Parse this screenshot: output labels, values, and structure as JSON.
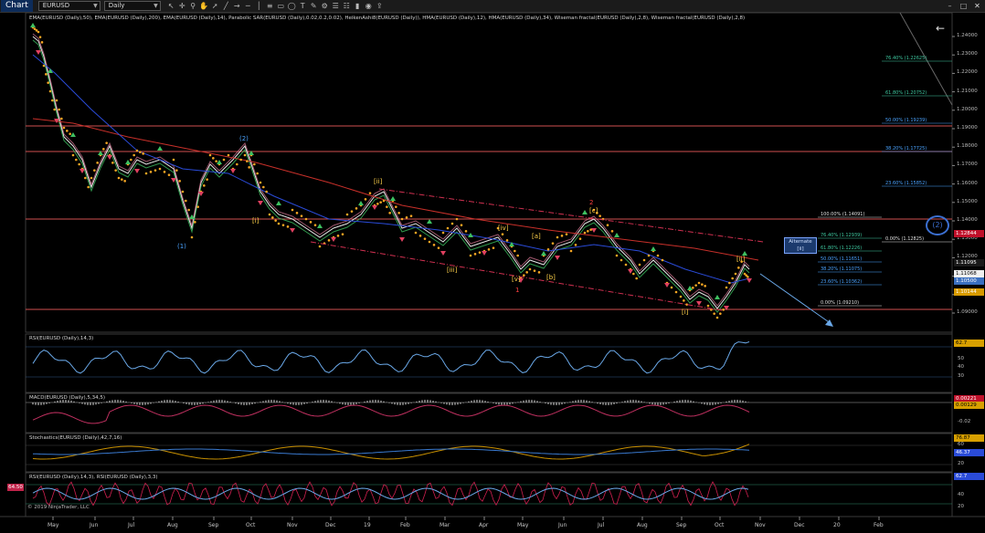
{
  "app": {
    "name": "Chart",
    "instrument": "EURUSD",
    "period": "Daily"
  },
  "toolbar": {
    "icons": [
      "cursor-icon",
      "crosshair-icon",
      "zoom-icon",
      "hand-icon",
      "arrow-icon",
      "line-icon",
      "ray-icon",
      "hline-icon",
      "vline-icon",
      "fib-icon",
      "rect-icon",
      "ellipse-icon",
      "text-icon",
      "pencil-icon",
      "gear-icon",
      "properties-icon",
      "list-icon",
      "bar-style-icon",
      "camera-icon",
      "share-icon"
    ]
  },
  "window": {
    "controls": [
      "minimize",
      "maximize",
      "close"
    ]
  },
  "main_pane": {
    "label": "EMA(EURUSD (Daily),50), EMA(EURUSD (Daily),200), EMA(EURUSD (Daily),14), Parabolic SAR(EURUSD (Daily),0.02,0.2,0.02), HeikenAshi8(EURUSD (Daily)), HMA(EURUSD (Daily),12), HMA(EURUSD (Daily),34), Wiseman fractal(EURUSD (Daily),2,8), Wiseman fractal(EURUSD (Daily),2,8)",
    "y_ticks": [
      "1.24000",
      "1.23000",
      "1.22000",
      "1.21000",
      "1.20000",
      "1.19000",
      "1.18000",
      "1.17000",
      "1.16000",
      "1.15000",
      "1.14000",
      "1.13000",
      "1.12000",
      "1.11000",
      "1.10000",
      "1.09000"
    ],
    "price_badges": [
      {
        "label": "1.12844",
        "color": "#c0102a"
      },
      {
        "label": "1.11095",
        "color": "#1a1a1a"
      },
      {
        "label": "1.11068",
        "color": "#f0f0f0"
      },
      {
        "label": "1.10500",
        "color": "#3a6fc0"
      },
      {
        "label": "1.10144",
        "color": "#d89a00"
      }
    ],
    "fib_upper": [
      {
        "label": "76.40% (1.22625)",
        "color": "#3ec9a0"
      },
      {
        "label": "61.80% (1.20752)",
        "color": "#3ec9a0"
      },
      {
        "label": "50.00% (1.19239)",
        "color": "#4aa3ff"
      },
      {
        "label": "38.20% (1.17725)",
        "color": "#4aa3ff"
      },
      {
        "label": "23.60% (1.15852)",
        "color": "#4aa3ff"
      },
      {
        "label": "0.00% (1.12825)",
        "color": "#e0e0e0"
      }
    ],
    "fib_lower": [
      {
        "label": "100.00% (1.14091)",
        "color": "#e0e0e0"
      },
      {
        "label": "76.40% (1.12939)",
        "color": "#3ec9a0"
      },
      {
        "label": "61.80% (1.12226)",
        "color": "#3ec9a0"
      },
      {
        "label": "50.00% (1.11651)",
        "color": "#4aa3ff"
      },
      {
        "label": "38.20% (1.11075)",
        "color": "#4aa3ff"
      },
      {
        "label": "23.60% (1.10362)",
        "color": "#4aa3ff"
      },
      {
        "label": "0.00% (1.09210)",
        "color": "#e0e0e0"
      }
    ],
    "wave_labels": [
      {
        "text": "(2)",
        "color": "#4aa3ff"
      },
      {
        "text": "(1)",
        "color": "#4aa3ff"
      },
      {
        "text": "[i]",
        "color": "#ffd24a"
      },
      {
        "text": "[ii]",
        "color": "#ffd24a"
      },
      {
        "text": "[iii]",
        "color": "#ffd24a"
      },
      {
        "text": "[iv]",
        "color": "#ffd24a"
      },
      {
        "text": "[v]",
        "color": "#ffd24a"
      },
      {
        "text": "[a]",
        "color": "#ffd24a"
      },
      {
        "text": "[b]",
        "color": "#ffd24a"
      },
      {
        "text": "[c]",
        "color": "#ffd24a"
      },
      {
        "text": "2",
        "color": "#ff4040"
      },
      {
        "text": "1",
        "color": "#ff4040"
      },
      {
        "text": "[i]",
        "color": "#ffd24a"
      },
      {
        "text": "[ii]",
        "color": "#ffd24a"
      }
    ],
    "alternate_label": {
      "line1": "Alternate",
      "line2": "[ii]"
    },
    "circle_label": "(2)"
  },
  "rsi_pane": {
    "label": "RSI(EURUSD (Daily),14,3)",
    "y_ticks": [
      "70",
      "50",
      "40",
      "30"
    ],
    "value": "62.7"
  },
  "macd_pane": {
    "label": "MACD(EURUSD (Daily),5,34,5)",
    "y_ticks": [
      "-0.02"
    ],
    "values": [
      "0.00221",
      "0.00129"
    ]
  },
  "stoch_pane": {
    "label": "Stochastics(EURUSD (Daily),42,7,16)",
    "y_ticks": [
      "60",
      "40",
      "20"
    ],
    "values": [
      "76.87",
      "46.37"
    ]
  },
  "rsi2_pane": {
    "label": "RSI(EURUSD (Daily),14,3), RSI(EURUSD (Daily),3,3)",
    "y_ticks": [
      "40",
      "20"
    ],
    "value": "62.7",
    "left_value": "64.50"
  },
  "copyright": "© 2019 NinjaTrader, LLC",
  "x_ticks": [
    "May",
    "Jun",
    "Jul",
    "Aug",
    "Sep",
    "Oct",
    "Nov",
    "Dec",
    "19",
    "Feb",
    "Mar",
    "Apr",
    "May",
    "Jun",
    "Jul",
    "Aug",
    "Sep",
    "Oct",
    "Nov",
    "Dec",
    "20",
    "Feb"
  ],
  "colors": {
    "ema200": "#c8302a",
    "ema50": "#2a4bd8",
    "sar": "#f5a623",
    "price": "#e8e8e8",
    "hline": "#d05050",
    "rsi": "#6aa8e8"
  }
}
